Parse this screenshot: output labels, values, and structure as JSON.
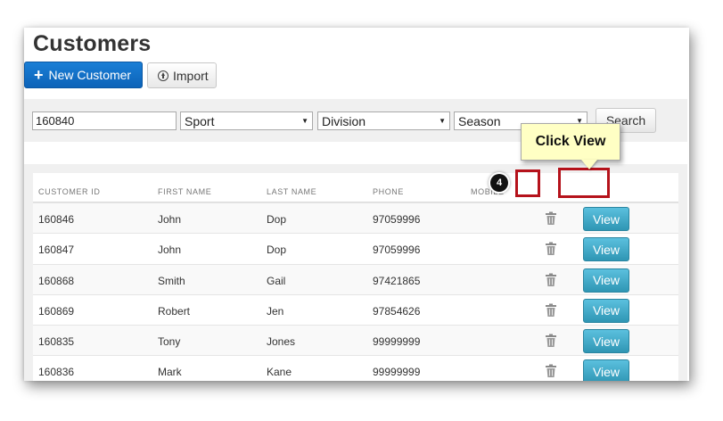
{
  "page": {
    "title": "Customers",
    "new_button": "New Customer",
    "import_button": "Import"
  },
  "filters": {
    "search_value": "160840",
    "sport": "Sport",
    "division": "Division",
    "season": "Season",
    "search_button": "Search"
  },
  "table": {
    "headers": {
      "customer_id": "CUSTOMER ID",
      "first_name": "FIRST NAME",
      "last_name": "LAST NAME",
      "phone": "PHONE",
      "mobile": "MOBILE"
    },
    "view_label": "View",
    "rows": [
      {
        "id": "160846",
        "first": "John",
        "last": "Dop",
        "phone": "97059996",
        "mobile": ""
      },
      {
        "id": "160847",
        "first": "John",
        "last": "Dop",
        "phone": "97059996",
        "mobile": ""
      },
      {
        "id": "160868",
        "first": "Smith",
        "last": "Gail",
        "phone": "97421865",
        "mobile": ""
      },
      {
        "id": "160869",
        "first": "Robert",
        "last": "Jen",
        "phone": "97854626",
        "mobile": ""
      },
      {
        "id": "160835",
        "first": "Tony",
        "last": "Jones",
        "phone": "99999999",
        "mobile": ""
      },
      {
        "id": "160836",
        "first": "Mark",
        "last": "Kane",
        "phone": "99999999",
        "mobile": ""
      }
    ]
  },
  "annotation": {
    "callout": "Click View",
    "step": "4"
  },
  "icons": {
    "add": "plus-icon",
    "import": "upload-circle-icon",
    "delete": "trash-icon",
    "dropdown": "caret-down-icon"
  },
  "colors": {
    "primary": "#0c63b8",
    "info": "#2f96b4",
    "highlight": "#b5121b",
    "callout_bg": "#ffffc4"
  }
}
